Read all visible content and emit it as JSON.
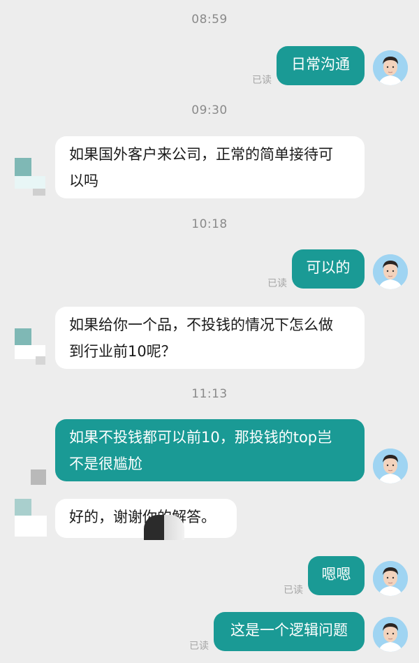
{
  "chat": {
    "read_label": "已读",
    "messages": [
      {
        "time": "08:59",
        "sender": "me",
        "text": "日常沟通",
        "read": true
      },
      {
        "time": "09:30",
        "sender": "other",
        "text": "如果国外客户来公司，正常的简单接待可以吗",
        "line1": "如果国外客户来公司，正常的简单接待可",
        "line2": "以吗"
      },
      {
        "time": "10:18",
        "sender": "me",
        "text": "可以的",
        "read": true
      },
      {
        "sender": "other",
        "text": "如果给你一个品，不投钱的情况下怎么做到行业前10呢？",
        "line1": "如果给你一个品，不投钱的情况下怎么做",
        "line2": "到行业前10呢？"
      },
      {
        "time": "11:13",
        "sender": "me",
        "text": "如果不投钱都可以前10，那投钱的top岂不是很尴尬",
        "line1": "如果不投钱都可以前10，那投钱的top岂",
        "line2": "不是很尴尬"
      },
      {
        "sender": "other",
        "text": "好的，谢谢你的解答。"
      },
      {
        "sender": "me",
        "text": "嗯嗯",
        "read": true
      },
      {
        "sender": "me",
        "text": "这是一个逻辑问题",
        "read": true
      }
    ]
  },
  "avatars": {
    "me": "user-avatar-photo",
    "other": "contact-avatar-blurred"
  },
  "colors": {
    "outgoing": "#1a9a95",
    "incoming": "#ffffff",
    "background": "#ededed"
  }
}
